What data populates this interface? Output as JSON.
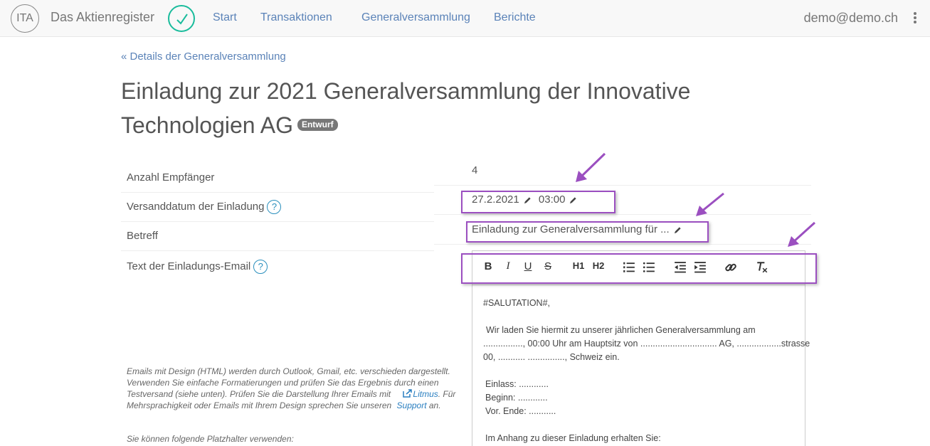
{
  "navbar": {
    "logo_text": "ITA",
    "brand": "Das Aktienregister",
    "links": [
      "Start",
      "Transaktionen",
      "Generalversammlung",
      "Berichte"
    ],
    "user_email": "demo@demo.ch",
    "accent_color": "#1abc9c"
  },
  "breadcrumb": "« Details der Generalversammlung",
  "title_line1": "Einladung zur 2021 Generalversammlung der Innovative",
  "title_line2": "Technologien AG",
  "status_badge": "Entwurf",
  "form": {
    "recipients_label": "Anzahl Empfänger",
    "recipients_value": "4",
    "send_date_label": "Versanddatum der Einladung",
    "send_date_value": "27.2.2021",
    "send_time_value": "03:00",
    "subject_label": "Betreff",
    "subject_value": "Einladung zur Generalversammlung für ...",
    "email_text_label": "Text der Einladungs-Email",
    "help_icon": "?"
  },
  "toolbar": {
    "bold": "B",
    "italic": "I",
    "underline": "U",
    "strike": "S",
    "h1": "H1",
    "h2": "H2"
  },
  "editor_lines": [
    "#SALUTATION#,",
    "Wir laden Sie hiermit zu unserer jährlichen Generalversammlung am",
    "................, 00:00 Uhr am Hauptsitz von ............................... AG, ..................strasse",
    "00, ........... ..............., Schweiz ein.",
    "Einlass: ............",
    "Beginn: ............",
    "Vor. Ende: ...........",
    "Im Anhang zu dieser Einladung erhalten Sie:"
  ],
  "notes": {
    "part1": "Emails mit Design (HTML) werden durch Outlook, Gmail, etc. verschieden dargestellt. Verwenden Sie einfache Formatierungen und prüfen Sie das Ergebnis durch einen Testversand (siehe unten). Prüfen Sie die Darstellung Ihrer Emails mit",
    "litmus": "Litmus",
    "part2": ". Für Mehrsprachigkeit oder Emails mit Ihrem Design sprechen Sie unseren",
    "support": "Support",
    "part3": " an.",
    "placeholders": "Sie können folgende Platzhalter verwenden:"
  },
  "highlight_color": "#9b4fc0"
}
